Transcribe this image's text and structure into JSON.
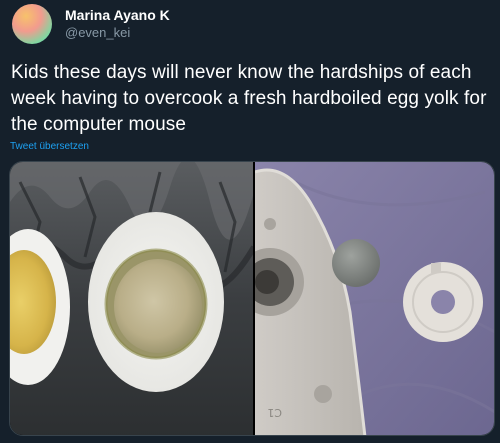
{
  "author": {
    "display_name": "Marina Ayano K",
    "handle": "@even_kei"
  },
  "tweet": {
    "text": "Kids these days will never know the hardships of each week having to overcook a fresh hardboiled egg yolk for the computer mouse",
    "translate_label": "Tweet übersetzen"
  },
  "media": {
    "photos": [
      {
        "name": "halved-hardboiled-eggs"
      },
      {
        "name": "mouse-ball-and-retainer-ring"
      }
    ],
    "photo2_marking": "C1"
  },
  "colors": {
    "background": "#15202b",
    "text_primary": "#ffffff",
    "text_secondary": "#8899a6",
    "link": "#1da1f2",
    "border": "#38444d"
  }
}
